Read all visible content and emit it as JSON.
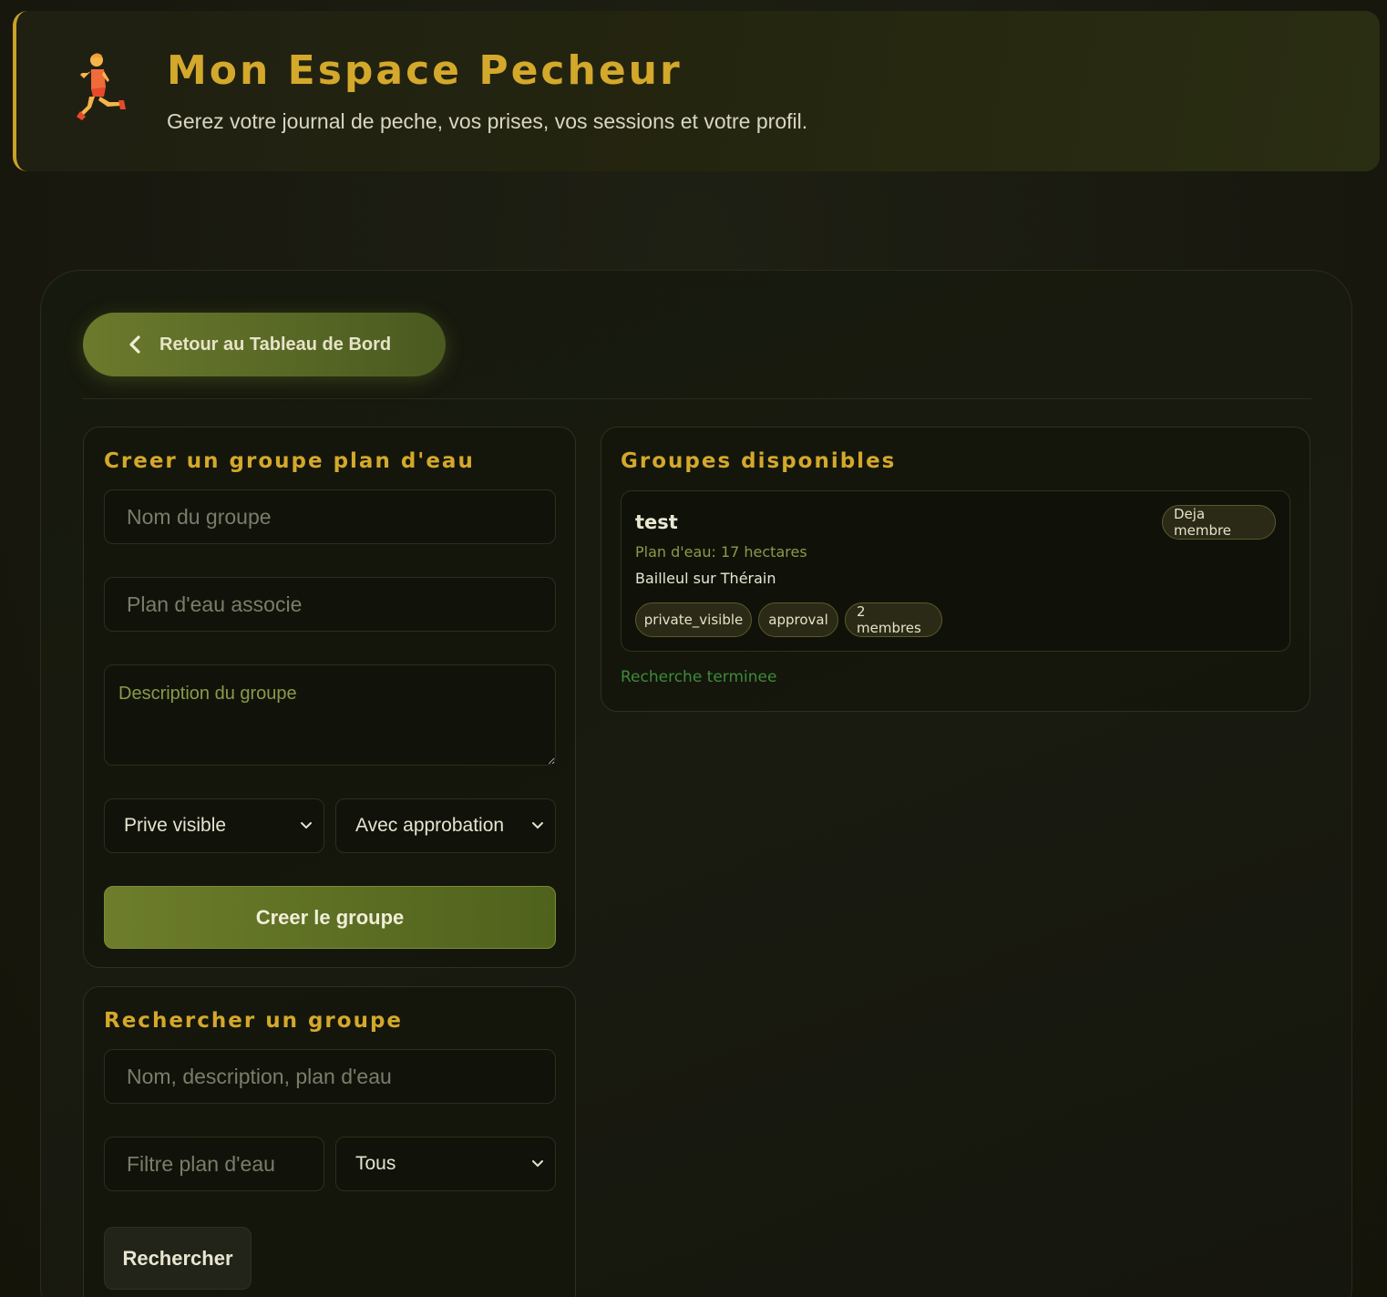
{
  "header": {
    "title": "Mon Espace Pecheur",
    "subtitle": "Gerez votre journal de peche, vos prises, vos sessions et votre profil.",
    "icon": "runner-icon"
  },
  "nav": {
    "back_label": "Retour au Tableau de Bord"
  },
  "create_group": {
    "title": "Creer un groupe plan d'eau",
    "name_placeholder": "Nom du groupe",
    "water_placeholder": "Plan d'eau associe",
    "description_placeholder": "Description du groupe",
    "visibility_value": "Prive visible",
    "approval_value": "Avec approbation",
    "submit_label": "Creer le groupe"
  },
  "search_group": {
    "title": "Rechercher un groupe",
    "query_placeholder": "Nom, description, plan d'eau",
    "water_filter_placeholder": "Filtre plan d'eau",
    "type_filter_value": "Tous",
    "submit_label": "Rechercher"
  },
  "available_groups": {
    "title": "Groupes disponibles",
    "items": [
      {
        "name": "test",
        "plan": "Plan d'eau: 17 hectares",
        "location": "Bailleul sur Thérain",
        "membership": "Deja membre",
        "tags": [
          "private_visible",
          "approval",
          "2 membres"
        ]
      }
    ],
    "status": "Recherche terminee"
  },
  "colors": {
    "accent": "#d4a82b",
    "primary": "#6b7a2c",
    "background": "#18180f",
    "status_ok": "#3e8a3a"
  }
}
